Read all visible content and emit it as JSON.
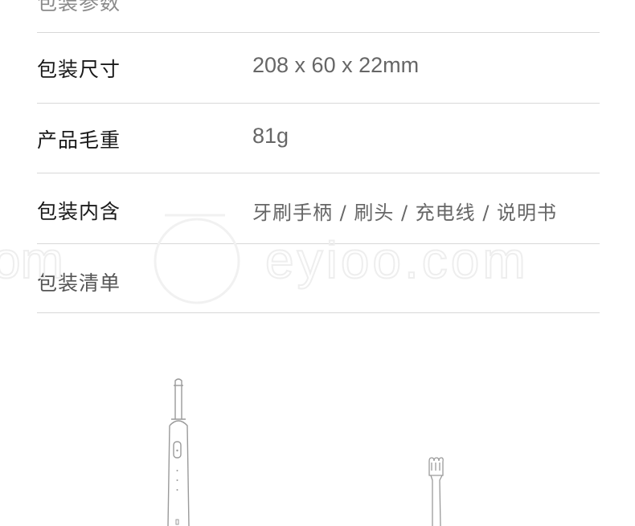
{
  "section": {
    "title": "包装参数"
  },
  "rows": [
    {
      "label": "包装尺寸",
      "value": "208 x 60 x 22mm"
    },
    {
      "label": "产品毛重",
      "value": "81g"
    },
    {
      "label": "包装内含",
      "value": "牙刷手柄 / 刷头 / 充电线 / 说明书"
    },
    {
      "label": "包装清单",
      "value": ""
    }
  ],
  "watermark": {
    "text": "eyioo.com",
    "left_fragment": "om"
  },
  "images": {
    "handle": "toothbrush-handle-line-drawing",
    "head": "brush-head-line-drawing"
  },
  "colors": {
    "line": "#d8d8d8",
    "label": "#1a1a1a",
    "value": "#666666"
  }
}
